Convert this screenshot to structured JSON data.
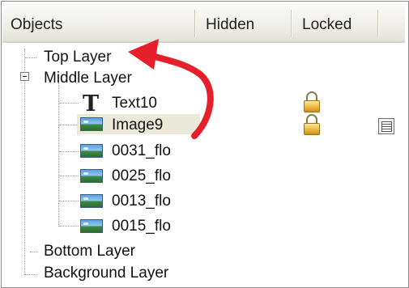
{
  "columns": {
    "objects": "Objects",
    "hidden": "Hidden",
    "locked": "Locked"
  },
  "tree": {
    "top_layer": "Top Layer",
    "middle_layer": "Middle Layer",
    "children": {
      "text10": "Text10",
      "image9": "Image9",
      "img_0031": "0031_flo",
      "img_0025": "0025_flo",
      "img_0013": "0013_flo",
      "img_0015": "0015_flo"
    },
    "bottom_layer": "Bottom Layer",
    "background_layer": "Background Layer"
  },
  "selected_item": "Image9",
  "locked_items": [
    "Text10",
    "Image9"
  ],
  "colors": {
    "arrow": "#e5202a",
    "selection": "#eae8d8",
    "header": "#ecebe4"
  }
}
